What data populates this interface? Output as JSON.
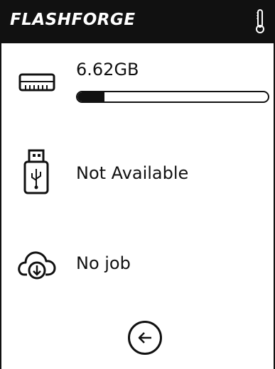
{
  "header": {
    "brand": "FLASHFORGE",
    "thermometer_icon": "thermometer-icon"
  },
  "storage": {
    "icon": "memory-card-icon",
    "size": "6.62GB",
    "used_fraction": 0.14
  },
  "usb": {
    "icon": "usb-drive-icon",
    "status": "Not Available"
  },
  "cloud": {
    "icon": "cloud-download-icon",
    "status": "No job"
  },
  "nav": {
    "back_icon": "back-arrow-icon"
  }
}
